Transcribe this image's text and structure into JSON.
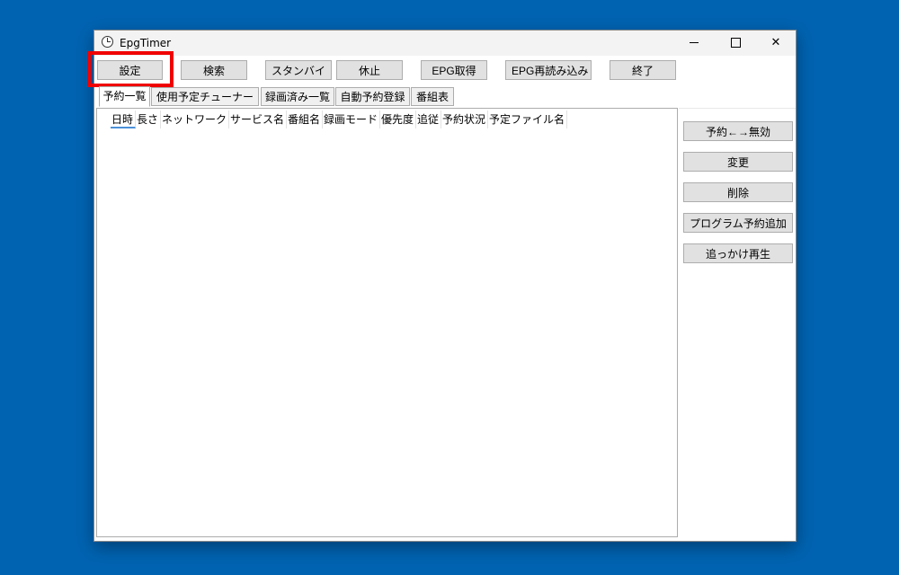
{
  "window": {
    "title": "EpgTimer"
  },
  "window_controls": {
    "minimize": "minimize",
    "maximize": "maximize",
    "close": "✕"
  },
  "toolbar": [
    {
      "name": "settings-button",
      "label": "設定"
    },
    {
      "name": "search-button",
      "label": "検索"
    },
    {
      "name": "standby-button",
      "label": "スタンバイ"
    },
    {
      "name": "suspend-button",
      "label": "休止"
    },
    {
      "name": "epg-acquire-button",
      "label": "EPG取得"
    },
    {
      "name": "epg-reload-button",
      "label": "EPG再読み込み"
    },
    {
      "name": "exit-button",
      "label": "終了"
    }
  ],
  "tabs": [
    {
      "label": "予約一覧",
      "active": true
    },
    {
      "label": "使用予定チューナー",
      "active": false
    },
    {
      "label": "録画済み一覧",
      "active": false
    },
    {
      "label": "自動予約登録",
      "active": false
    },
    {
      "label": "番組表",
      "active": false
    }
  ],
  "columns": [
    "日時",
    "長さ",
    "ネットワーク",
    "サービス名",
    "番組名",
    "録画モード",
    "優先度",
    "追従",
    "予約状況",
    "予定ファイル名"
  ],
  "side_buttons": [
    {
      "name": "toggle-reserve-button",
      "label": "予約←→無効"
    },
    {
      "name": "change-button",
      "label": "変更"
    },
    {
      "name": "delete-button",
      "label": "削除"
    },
    {
      "name": "add-program-reserve-button",
      "label": "プログラム予約追加"
    },
    {
      "name": "chase-play-button",
      "label": "追っかけ再生"
    }
  ],
  "colors": {
    "desktop": "#0063b1",
    "highlight": "#f00000"
  }
}
